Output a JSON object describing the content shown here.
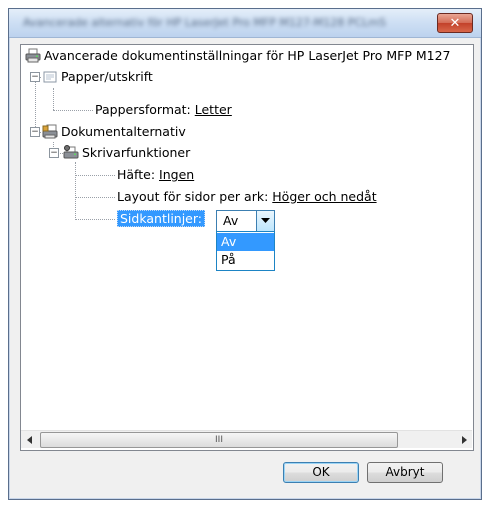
{
  "window": {
    "title": "Avancerade alternativ för HP LaserJet Pro MFP M127-M128 PCLmS",
    "close_glyph": "✕"
  },
  "tree": {
    "root": "Avancerade dokumentinställningar för HP LaserJet Pro MFP M127",
    "paper": {
      "label": "Papper/utskrift",
      "format_label": "Pappersformat:",
      "format_value": "Letter"
    },
    "document": {
      "label": "Dokumentalternativ",
      "printer_features": {
        "label": "Skrivarfunktioner",
        "booklet_label": "Häfte:",
        "booklet_value": "Ingen",
        "layout_label": "Layout för sidor per ark:",
        "layout_value": "Höger och nedåt",
        "borders_label": "Sidkantlinjer:"
      }
    }
  },
  "combo": {
    "value": "Av",
    "options": [
      "Av",
      "På"
    ],
    "selected_index": 0
  },
  "scrollbar": {
    "grip": "III"
  },
  "buttons": {
    "ok": "OK",
    "cancel": "Avbryt"
  },
  "colors": {
    "selection": "#3399ff",
    "combo_border": "#3c7fb1"
  },
  "icons": [
    "printer-icon",
    "paper-icon",
    "document-options-icon",
    "printer-features-icon",
    "expander-minus-icon",
    "dropdown-arrow-icon",
    "scroll-left-icon",
    "scroll-right-icon"
  ]
}
